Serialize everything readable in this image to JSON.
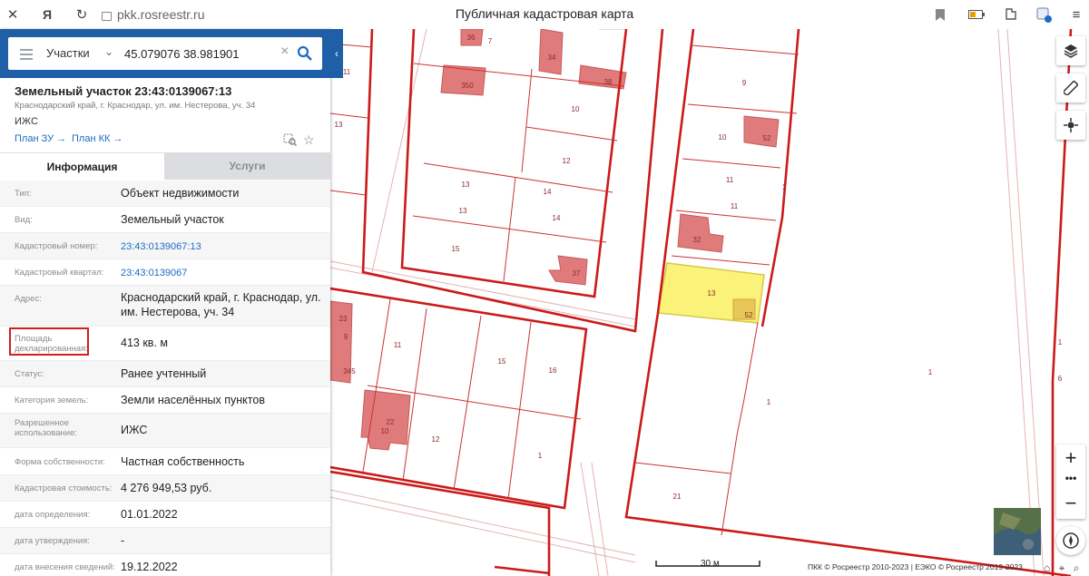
{
  "browser": {
    "url": "pkk.rosreestr.ru",
    "title": "Публичная кадастровая карта",
    "icons": [
      "close-icon",
      "yandex-icon",
      "reload-icon",
      "lock-icon",
      "bookmark-icon",
      "battery-icon",
      "extensions-icon",
      "profile-icon",
      "menu-icon"
    ]
  },
  "search": {
    "type_label": "Участки",
    "value": "45.079076 38.981901"
  },
  "object": {
    "title": "Земельный участок 23:43:0139067:13",
    "address": "Краснодарский край, г. Краснодар, ул. им. Нестерова, уч. 34",
    "usage": "ИЖС",
    "plan_zu": "План ЗУ",
    "plan_kk": "План КК"
  },
  "tabs": {
    "info": "Информация",
    "services": "Услуги"
  },
  "details": [
    {
      "key": "Тип:",
      "value": "Объект недвижимости"
    },
    {
      "key": "Вид:",
      "value": "Земельный участок"
    },
    {
      "key": "Кадастровый номер:",
      "value": "23:43:0139067:13"
    },
    {
      "key": "Кадастровый квартал:",
      "value": "23:43:0139067"
    },
    {
      "key": "Адрес:",
      "value": "Краснодарский край, г. Краснодар, ул. им. Нестерова, уч. 34"
    },
    {
      "key": "Площадь декларированная:",
      "value": "413 кв. м"
    },
    {
      "key": "Статус:",
      "value": "Ранее учтенный"
    },
    {
      "key": "Категория земель:",
      "value": "Земли населённых пунктов"
    },
    {
      "key": "Разрешенное использование:",
      "value": "ИЖС"
    },
    {
      "key": "Форма собственности:",
      "value": "Частная собственность"
    },
    {
      "key": "Кадастровая стоимость:",
      "value": "4 276 949,53 руб."
    },
    {
      "key": "дата определения:",
      "value": "01.01.2022"
    },
    {
      "key": "дата утверждения:",
      "value": "-"
    },
    {
      "key": "дата внесения сведений:",
      "value": "19.12.2022"
    }
  ],
  "map": {
    "labels": [
      "36",
      "7",
      "11",
      "34",
      "38",
      "350",
      "10",
      "13",
      "12",
      "13",
      "14",
      "13",
      "14",
      "15",
      "37",
      "9",
      "10",
      "52",
      "11",
      "11",
      "1",
      "32",
      "13",
      "52",
      "23",
      "9",
      "345",
      "11",
      "15",
      "16",
      "22",
      "10",
      "12",
      "1",
      "1",
      "1",
      "21",
      "6",
      "1"
    ],
    "scale": "30 м",
    "copyright": "ПКК © Росреестр 2010-2023 | ЕЭКО © Росреестр 2019-2023",
    "colors": {
      "boundary": "#cc1a1a",
      "building": "#e07b7b",
      "selected": "#fbf27a"
    }
  }
}
